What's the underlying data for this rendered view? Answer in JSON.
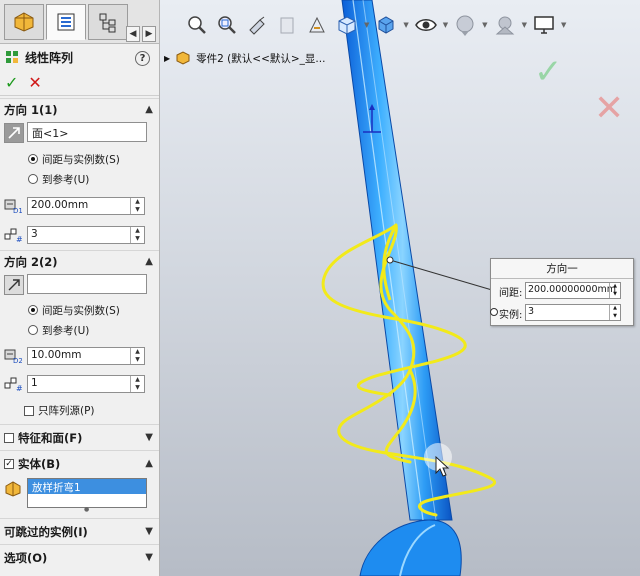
{
  "feature": {
    "title": "线性阵列",
    "help": "?",
    "ok": "✓",
    "cancel": "✕"
  },
  "direction1": {
    "header": "方向 1(1)",
    "selection": "面<1>",
    "option_spacing": "间距与实例数(S)",
    "option_reference": "到参考(U)",
    "spacing": "200.00mm",
    "instances": "3",
    "spacing_badge": "D1"
  },
  "direction2": {
    "header": "方向 2(2)",
    "selection": "",
    "option_spacing": "间距与实例数(S)",
    "option_reference": "到参考(U)",
    "spacing": "10.00mm",
    "instances": "1",
    "spacing_badge": "D2",
    "pattern_seed_only": "只阵列源(P)"
  },
  "sections": {
    "features_faces": "特征和面(F)",
    "bodies": "实体(B)",
    "bodies_item": "放样折弯1",
    "skip_instances": "可跳过的实例(I)",
    "options": "选项(O)"
  },
  "tree": {
    "part_label": "零件2 (默认<<默认>_显..."
  },
  "callout": {
    "title": "方向一",
    "spacing_label": "间距:",
    "spacing_value": "200.00000000mm",
    "instances_label": "实例:",
    "instances_value": "3"
  },
  "colors": {
    "accent_blue": "#1f8fff",
    "preview_yellow": "#f2ea1a",
    "ok_green": "#1e9a1e",
    "cancel_red": "#d01818"
  }
}
